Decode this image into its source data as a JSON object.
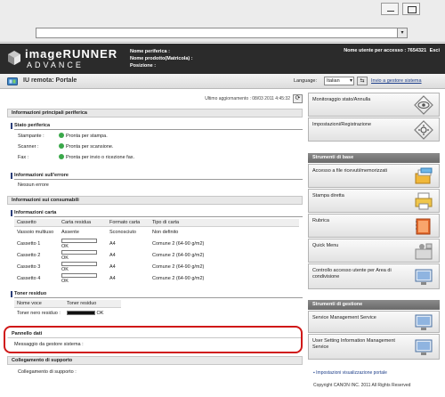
{
  "header": {
    "brand": "imageRUNNER",
    "brand_sub": "ADVANCE",
    "device_name_label": "Nome periferica :",
    "product_name_label": "Nome prodotto(Matricola) :",
    "position_label": "Posizione :",
    "user_label": "Nome utente per accesso : 7654321",
    "logout": "Esci"
  },
  "portal": {
    "title": "IU remota: Portale",
    "language_label": "Language:",
    "language_value": "Italian",
    "sysadmin_link": "Invio a gestore sistema"
  },
  "main": {
    "last_updated": "Ultimo aggiornamento : 08/03 2011 4:45:32",
    "device_info_header": "Informazioni principali periferica",
    "status_header": "Stato periferica",
    "status_rows": [
      {
        "label": "Stampante :",
        "value": "Pronta per stampa."
      },
      {
        "label": "Scanner :",
        "value": "Pronta per scansione."
      },
      {
        "label": "Fax :",
        "value": "Pronta per invio o ricezione fax."
      }
    ],
    "error_header": "Informazioni sull'errore",
    "error_value": "Nessun errore",
    "consumables_header": "Informazioni sui consumabili",
    "paper_header": "Informazioni carta",
    "paper_columns": [
      "Cassetto",
      "Carta residua",
      "Formato carta",
      "Tipo di carta"
    ],
    "paper_rows": [
      {
        "drawer": "Vassoio multiuso",
        "remaining": "Assente",
        "size": "Sconosciuto",
        "type": "Non definito"
      },
      {
        "drawer": "Cassetto 1",
        "remaining": "OK",
        "size": "A4",
        "type": "Comune 2 (64-90 g/m2)"
      },
      {
        "drawer": "Cassetto 2",
        "remaining": "OK",
        "size": "A4",
        "type": "Comune 2 (64-90 g/m2)"
      },
      {
        "drawer": "Cassetto 3",
        "remaining": "OK",
        "size": "A4",
        "type": "Comune 2 (64-90 g/m2)"
      },
      {
        "drawer": "Cassetto 4",
        "remaining": "OK",
        "size": "A4",
        "type": "Comune 2 (64-90 g/m2)"
      }
    ],
    "toner_header": "Toner residuo",
    "toner_columns": [
      "Nome voce",
      "Toner residuo"
    ],
    "toner_row": {
      "name": "Toner nero residuo :",
      "value": "OK"
    },
    "data_panel_header": "Pannello dati",
    "data_panel_message": "Messaggio da gestore sistema :",
    "support_header": "Collegamento di supporto",
    "support_label": "Collegamento di supporto :"
  },
  "side": {
    "btn_status_monitor": "Monitoraggio stato/Annulla",
    "btn_settings": "Impostazioni/Registrazione",
    "basic_tools_header": "Strumenti di base",
    "btn_access_files": "Accesso a file ricevuti/memorizzati",
    "btn_direct_print": "Stampa diretta",
    "btn_address_book": "Rubrica",
    "btn_quick_menu": "Quick Menu",
    "btn_access_control": "Controllo accesso utente per Area di condivisione",
    "mgmt_tools_header": "Strumenti di gestione",
    "btn_service_mgmt": "Service Management Service",
    "btn_user_setting": "User Setting Information Management Service",
    "portal_settings_link": "Impostazioni visualizzazione portale",
    "copyright": "Copyright CANON INC. 2011 All Rights Reserved"
  },
  "colors": {
    "header_bg": "#2b2b2b",
    "highlight_red": "#d01818",
    "status_green": "#3aa84a",
    "link_blue": "#1e3f8a"
  }
}
